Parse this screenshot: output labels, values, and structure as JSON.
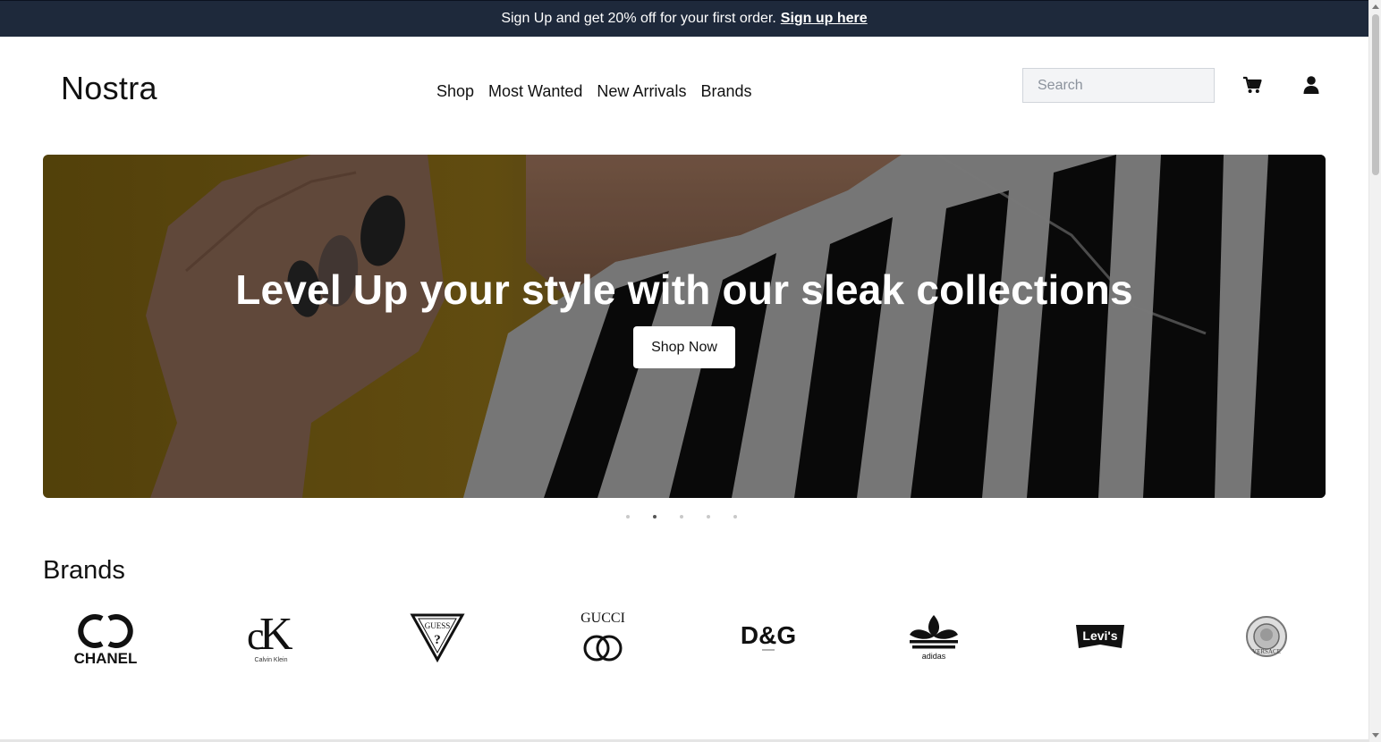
{
  "promo": {
    "text": "Sign Up and get 20% off for your first order.",
    "link_label": "Sign up here"
  },
  "header": {
    "logo": "Nostra",
    "nav": [
      "Shop",
      "Most Wanted",
      "New Arrivals",
      "Brands"
    ],
    "search_placeholder": "Search",
    "cart_icon": "cart-icon",
    "user_icon": "user-icon"
  },
  "hero": {
    "title": "Level Up your style with our sleak collections",
    "button_label": "Shop Now",
    "slide_count": 5,
    "active_slide": 2
  },
  "brands": {
    "title": "Brands",
    "items": [
      "CHANEL",
      "Calvin Klein",
      "GUESS",
      "GUCCI",
      "D&G",
      "adidas",
      "LEVI'S",
      "VERSACE"
    ]
  },
  "colors": {
    "promo_bg": "#1e293b",
    "text": "#111111",
    "white": "#ffffff",
    "hero_left_bg": "#6b5410"
  }
}
